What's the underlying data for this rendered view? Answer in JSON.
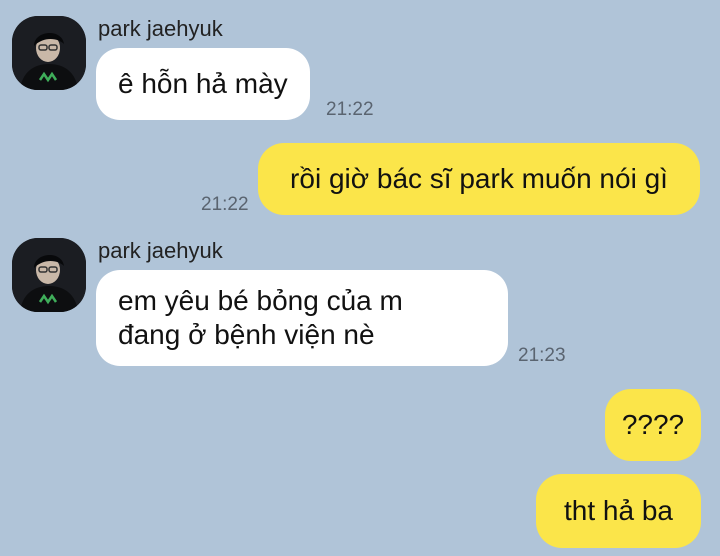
{
  "colors": {
    "background": "#b0c4d8",
    "incoming_bubble": "#ffffff",
    "outgoing_bubble": "#fbe54a",
    "timestamp": "#5a6470"
  },
  "messages": [
    {
      "direction": "incoming",
      "sender": "park jaehyuk",
      "avatar": "profile-photo",
      "lines": [
        "ê hỗn hả mày"
      ],
      "time": "21:22"
    },
    {
      "direction": "outgoing",
      "lines": [
        "rồi giờ bác sĩ park muốn nói gì"
      ],
      "time": "21:22"
    },
    {
      "direction": "incoming",
      "sender": "park jaehyuk",
      "avatar": "profile-photo",
      "lines": [
        "em yêu bé bỏng của m",
        "đang ở bệnh viện nè"
      ],
      "time": "21:23"
    },
    {
      "direction": "outgoing",
      "lines": [
        "????"
      ],
      "time": ""
    },
    {
      "direction": "outgoing",
      "lines": [
        "tht hả ba"
      ],
      "time": ""
    }
  ]
}
